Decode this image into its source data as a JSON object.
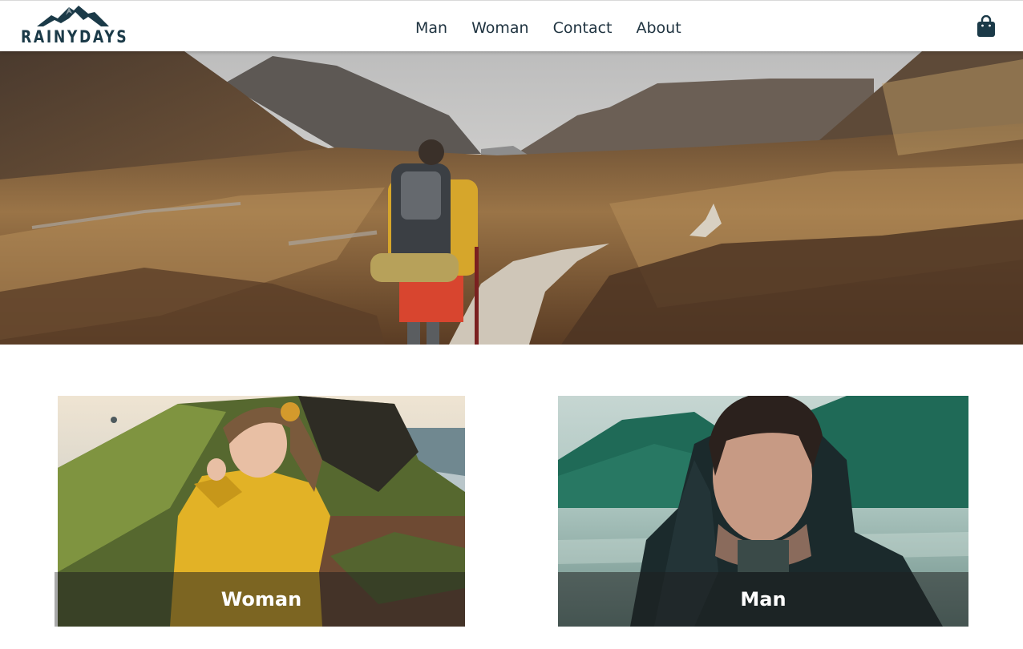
{
  "header": {
    "logo_text": "RAINYDAYS",
    "logo_icon": "mountain-logo-icon",
    "nav": [
      {
        "label": "Man"
      },
      {
        "label": "Woman"
      },
      {
        "label": "Contact"
      },
      {
        "label": "About"
      }
    ],
    "cart_icon": "shopping-bag-icon"
  },
  "hero": {
    "image": "hiker-in-mountain-valley-photo"
  },
  "categories": [
    {
      "label": "Woman",
      "image": "woman-in-yellow-raincoat-photo"
    },
    {
      "label": "Man",
      "image": "man-in-dark-rain-jacket-photo"
    }
  ],
  "colors": {
    "brand": "#1b3a48",
    "text": "#1f3340",
    "caption_overlay": "#1e1e1e"
  }
}
